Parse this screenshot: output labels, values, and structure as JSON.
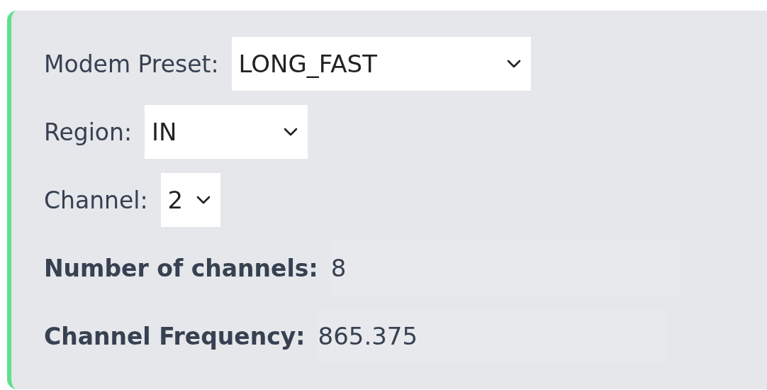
{
  "settings": [
    {
      "kind": "select",
      "label": "Modem Preset:",
      "value": "LONG_FAST"
    },
    {
      "kind": "select",
      "label": "Region:",
      "value": "IN"
    },
    {
      "kind": "select",
      "label": "Channel:",
      "value": "2"
    },
    {
      "kind": "readonly",
      "label": "Number of channels:",
      "value": "8"
    },
    {
      "kind": "readonly",
      "label": "Channel Frequency:",
      "value": "865.375"
    }
  ]
}
